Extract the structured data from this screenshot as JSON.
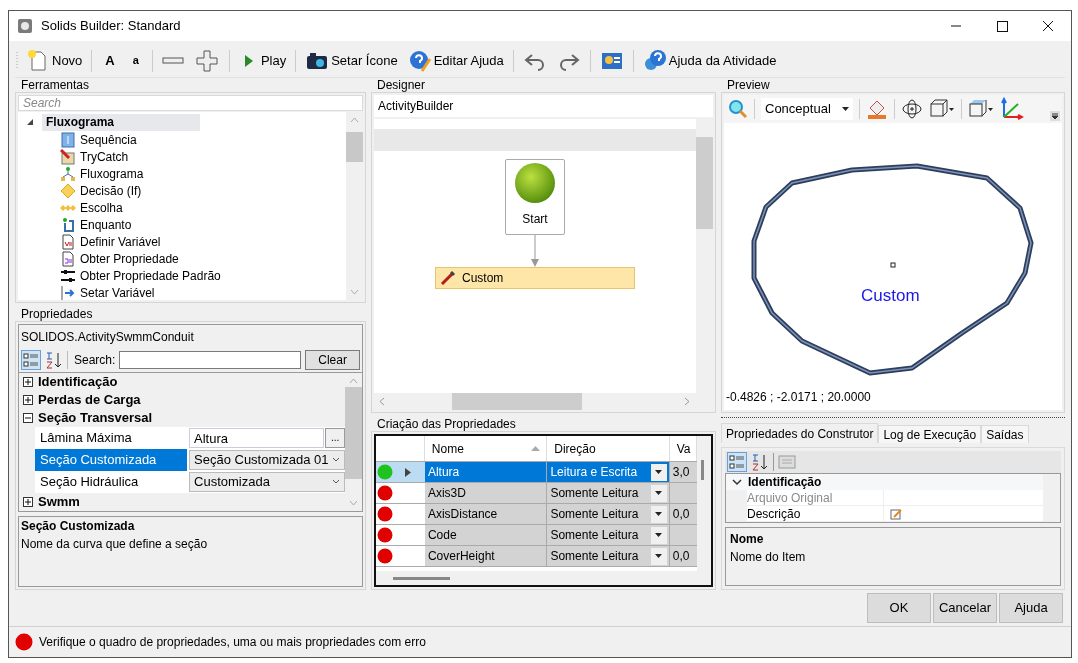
{
  "window": {
    "title": "Solids Builder: Standard"
  },
  "toolbar": [
    [
      {
        "kind": "icon_text",
        "label": "Novo"
      }
    ],
    [
      {
        "kind": "text",
        "label": "A"
      },
      {
        "kind": "text",
        "label": "a"
      }
    ],
    [
      {
        "kind": "icon"
      },
      {
        "kind": "icon"
      }
    ],
    [
      {
        "kind": "icon_text",
        "label": "Play"
      }
    ],
    [
      {
        "kind": "icon_text",
        "label": "Setar Ícone"
      },
      {
        "kind": "icon_text",
        "label": "Editar Ajuda"
      }
    ],
    [
      {
        "kind": "icon"
      },
      {
        "kind": "icon"
      }
    ],
    [
      {
        "kind": "icon"
      }
    ],
    [
      {
        "kind": "icon_text",
        "label": "Ajuda da Atividade"
      }
    ]
  ],
  "tools": {
    "title": "Ferramentas",
    "search_placeholder": "Search",
    "tree": [
      {
        "label": "Fluxograma",
        "expanded": true,
        "selected": true,
        "children": [
          {
            "label": "Sequência"
          },
          {
            "label": "TryCatch"
          },
          {
            "label": "Fluxograma"
          },
          {
            "label": "Decisão (If)"
          },
          {
            "label": "Escolha"
          },
          {
            "label": "Enquanto"
          },
          {
            "label": "Definir Variável"
          },
          {
            "label": "Obter Propriedade"
          },
          {
            "label": "Obter Propriedade Padrão"
          },
          {
            "label": "Setar Variável"
          }
        ]
      }
    ]
  },
  "properties": {
    "title": "Propriedades",
    "object": "SOLIDOS.ActivitySwmmConduit",
    "search_label": "Search:",
    "clear_button": "Clear",
    "categories": [
      {
        "label": "Identificação",
        "expanded": false
      },
      {
        "label": "Perdas de Carga",
        "expanded": false
      },
      {
        "label": "Seção Transversal",
        "expanded": true,
        "rows": [
          {
            "name": "Lâmina Máxima",
            "value": "Altura",
            "kind": "ellipsis",
            "button": "...",
            "selected": false
          },
          {
            "name": "Seção Customizada",
            "value": "Seção Customizada 01",
            "kind": "dropdown",
            "selected": true
          },
          {
            "name": "Seção Hidráulica",
            "value": "Customizada",
            "kind": "dropdown",
            "selected": false
          }
        ]
      },
      {
        "label": "Swmm",
        "expanded": false
      }
    ],
    "help_title": "Seção Customizada",
    "help_text": "Nome da curva que define a seção"
  },
  "designer": {
    "title": "Designer",
    "breadcrumb": "ActivityBuilder",
    "start_label": "Start",
    "activity_label": "Custom"
  },
  "creation": {
    "title": "Criação das Propriedades",
    "columns": [
      {
        "label": "Nome",
        "sorted": true
      },
      {
        "label": "Direção",
        "sorted": false
      },
      {
        "label": "Va",
        "sorted": false
      }
    ],
    "rows": [
      {
        "color": "#1ec31e",
        "selected": true,
        "name": "Altura",
        "direction": "Leitura e Escrita",
        "value": "3,0"
      },
      {
        "color": "#e00000",
        "selected": false,
        "name": "Axis3D",
        "direction": "Somente Leitura"
      },
      {
        "color": "#e00000",
        "selected": false,
        "name": "AxisDistance",
        "direction": "Somente Leitura",
        "value": "0,0"
      },
      {
        "color": "#e00000",
        "selected": false,
        "name": "Code",
        "direction": "Somente Leitura"
      },
      {
        "color": "#e00000",
        "selected": false,
        "name": "CoverHeight",
        "direction": "Somente Leitura",
        "value": "0,0"
      }
    ]
  },
  "preview": {
    "title": "Preview",
    "mode": "Conceptual",
    "shape_label": "Custom",
    "coordinates": "-0.4826 ; -2.0171 ; 20.0000"
  },
  "builder": {
    "tabs": [
      {
        "label": "Propriedades do Construtor",
        "selected": true
      },
      {
        "label": "Log de Execução",
        "selected": false
      },
      {
        "label": "Saídas",
        "selected": false
      }
    ],
    "category": {
      "label": "Identificação",
      "expanded": true,
      "rows": [
        {
          "name": "Arquivo Original",
          "disabled": true
        },
        {
          "name": "Descrição",
          "disabled": false
        }
      ]
    },
    "help_title": "Nome",
    "help_text": "Nome do Item"
  },
  "buttons": [
    "OK",
    "Cancelar",
    "Ajuda"
  ],
  "status": {
    "color": "#e00000",
    "text": "Verifique o quadro de propriedades, uma ou mais propriedades com erro"
  }
}
